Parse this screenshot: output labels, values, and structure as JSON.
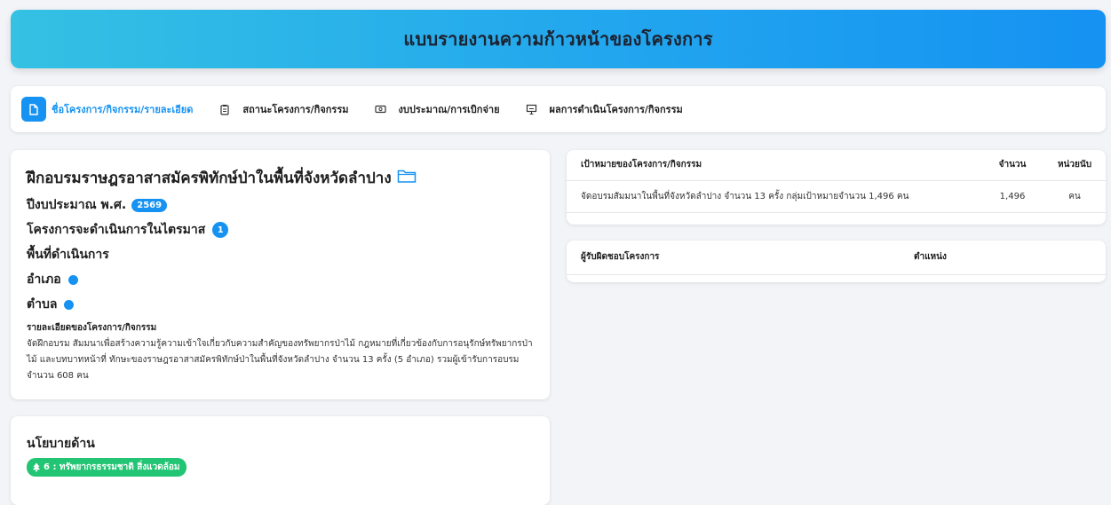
{
  "header": {
    "title": "แบบรายงานความก้าวหน้าของโครงการ"
  },
  "tabs": [
    {
      "label": "ชื่อโครงการ/กิจกรรม/รายละเอียด",
      "icon": "document-icon",
      "active": true
    },
    {
      "label": "สถานะโครงการ/กิจกรรม",
      "icon": "clipboard-icon",
      "active": false
    },
    {
      "label": "งบประมาณ/การเบิกจ่าย",
      "icon": "money-icon",
      "active": false
    },
    {
      "label": "ผลการดำเนินโครงการ/กิจกรรม",
      "icon": "presentation-icon",
      "active": false
    }
  ],
  "project": {
    "title": "ฝึกอบรมราษฎรอาสาสมัครพิทักษ์ป่าในพื้นที่จังหวัดลำปาง",
    "budget_year_label": "ปีงบประมาณ พ.ศ.",
    "budget_year": "2569",
    "quarter_label": "โครงการจะดำเนินการในไตรมาส",
    "quarter": "1",
    "area_label": "พื้นที่ดำเนินการ",
    "district_label": "อำเภอ",
    "subdistrict_label": "ตำบล",
    "detail_heading": "รายละเอียดของโครงการ/กิจกรรม",
    "detail_text": "จัดฝึกอบรม สัมมนาเพื่อสร้างความรู้ความเข้าใจเกี่ยวกับความสำคัญของทรัพยากรป่าไม้ กฎหมายที่เกี่ยวข้องกับการอนุรักษ์ทรัพยากรป่าไม้ และบทบาทหน้าที่ ทักษะของราษฎรอาสาสมัครพิทักษ์ป่าในพื้นที่จังหวัดลำปาง จำนวน 13 ครั้ง (5 อำเภอ) รวมผู้เข้ารับการอบรมจำนวน 608 คน"
  },
  "policy": {
    "title": "นโยบายด้าน",
    "badge": "6 : ทรัพยากรธรรมชาติ สิ่งแวดล้อม"
  },
  "targets": {
    "headers": {
      "target": "เป้าหมายของโครงการ/กิจกรรม",
      "amount": "จำนวน",
      "unit": "หน่วยนับ"
    },
    "rows": [
      {
        "target": "จัดอบรมสัมมนาในพื้นที่จังหวัดลำปาง จำนวน 13 ครั้ง กลุ่มเป้าหมายจำนวน 1,496 คน",
        "amount": "1,496",
        "unit": "คน"
      }
    ]
  },
  "owners": {
    "headers": {
      "name": "ผู้รับผิดชอบโครงการ",
      "position": "ตำแหน่ง"
    }
  },
  "colors": {
    "accent": "#1592f2",
    "policy_green": "#22c573"
  }
}
